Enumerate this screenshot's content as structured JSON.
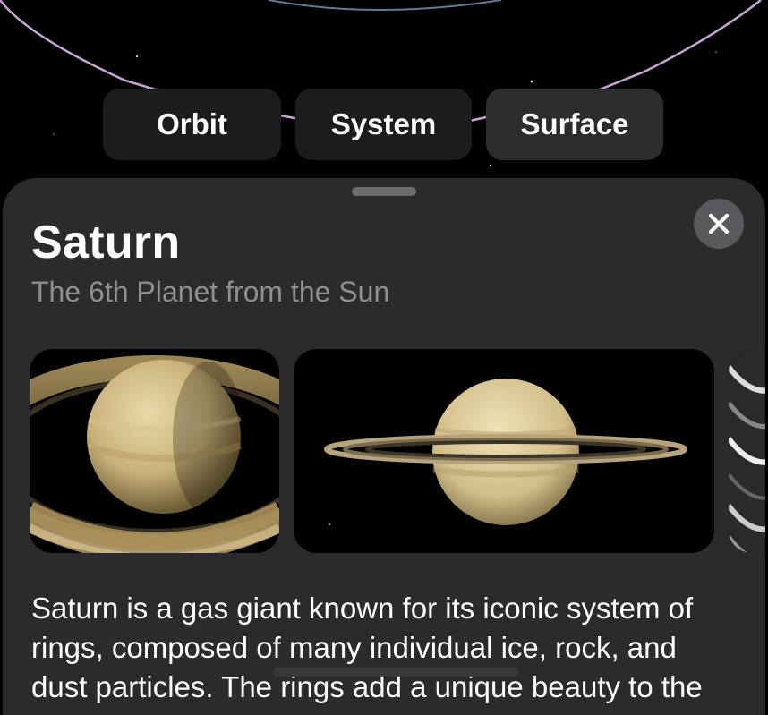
{
  "segments": {
    "orbit_label": "Orbit",
    "system_label": "System",
    "surface_label": "Surface",
    "selected": "Surface"
  },
  "sheet": {
    "title": "Saturn",
    "subtitle": "The 6th Planet from the Sun",
    "close_icon": "close-icon",
    "gallery": [
      {
        "name": "saturn-closeup-photo"
      },
      {
        "name": "saturn-ring-edge-photo"
      },
      {
        "name": "saturn-rings-detail-photo"
      }
    ],
    "description": "Saturn is a gas giant known for its iconic system of rings, composed of many individual ice, rock, and dust particles. The rings add a unique beauty to the planet."
  },
  "colors": {
    "sheet_background": "#2b2b2d",
    "segment_background": "#1c1c1e",
    "subtitle_color": "#8e8e93",
    "orbit_line": "#c7a6d6"
  }
}
